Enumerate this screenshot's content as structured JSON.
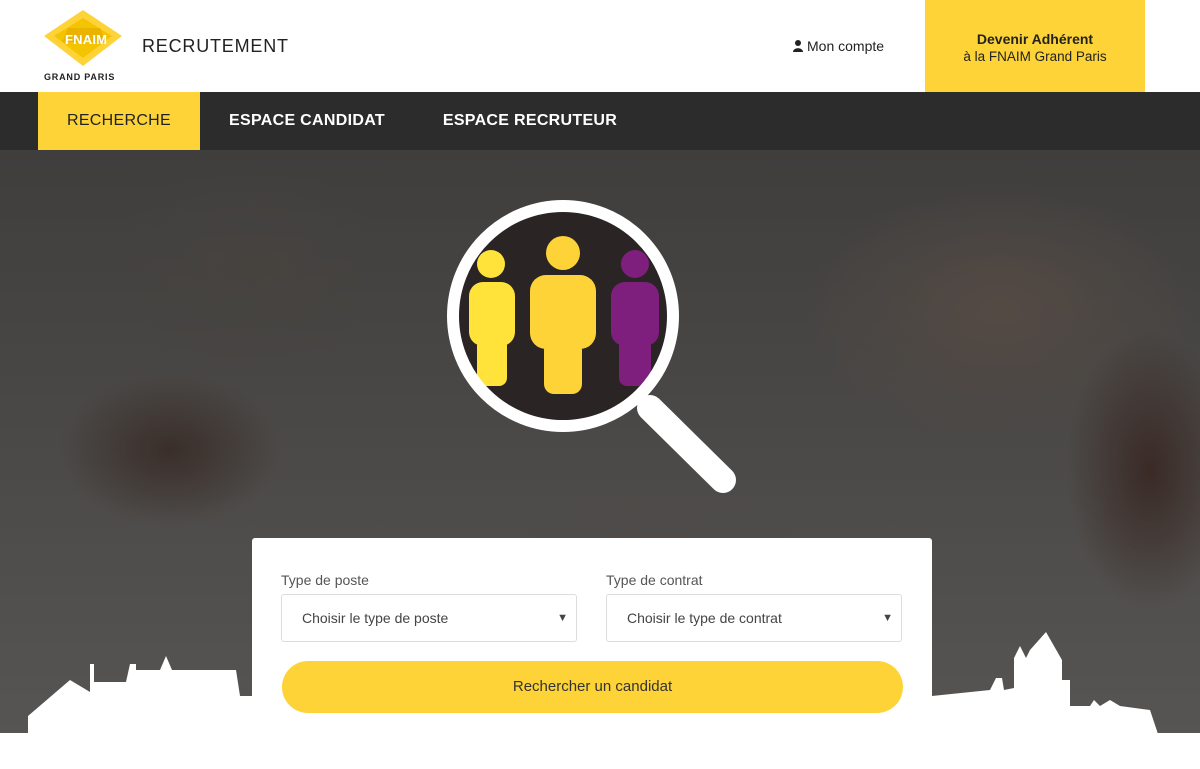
{
  "brand": {
    "logo_name": "FNAIM",
    "logo_subtitle": "GRAND PARIS",
    "site_title": "RECRUTEMENT"
  },
  "header": {
    "account_label": "Mon compte",
    "join_title": "Devenir Adhérent",
    "join_subtitle": "à la FNAIM Grand Paris"
  },
  "nav": {
    "items": [
      {
        "label": "RECHERCHE",
        "active": true
      },
      {
        "label": "ESPACE CANDIDAT",
        "active": false
      },
      {
        "label": "ESPACE RECRUTEUR",
        "active": false
      }
    ]
  },
  "search": {
    "post_type_label": "Type de poste",
    "post_type_value": "Choisir le type de poste",
    "contract_type_label": "Type de contrat",
    "contract_type_value": "Choisir le type de contrat",
    "submit_label": "Rechercher un candidat"
  },
  "colors": {
    "accent": "#fdd338",
    "nav_bg": "#2c2c2c",
    "purple": "#7e1f7e"
  }
}
